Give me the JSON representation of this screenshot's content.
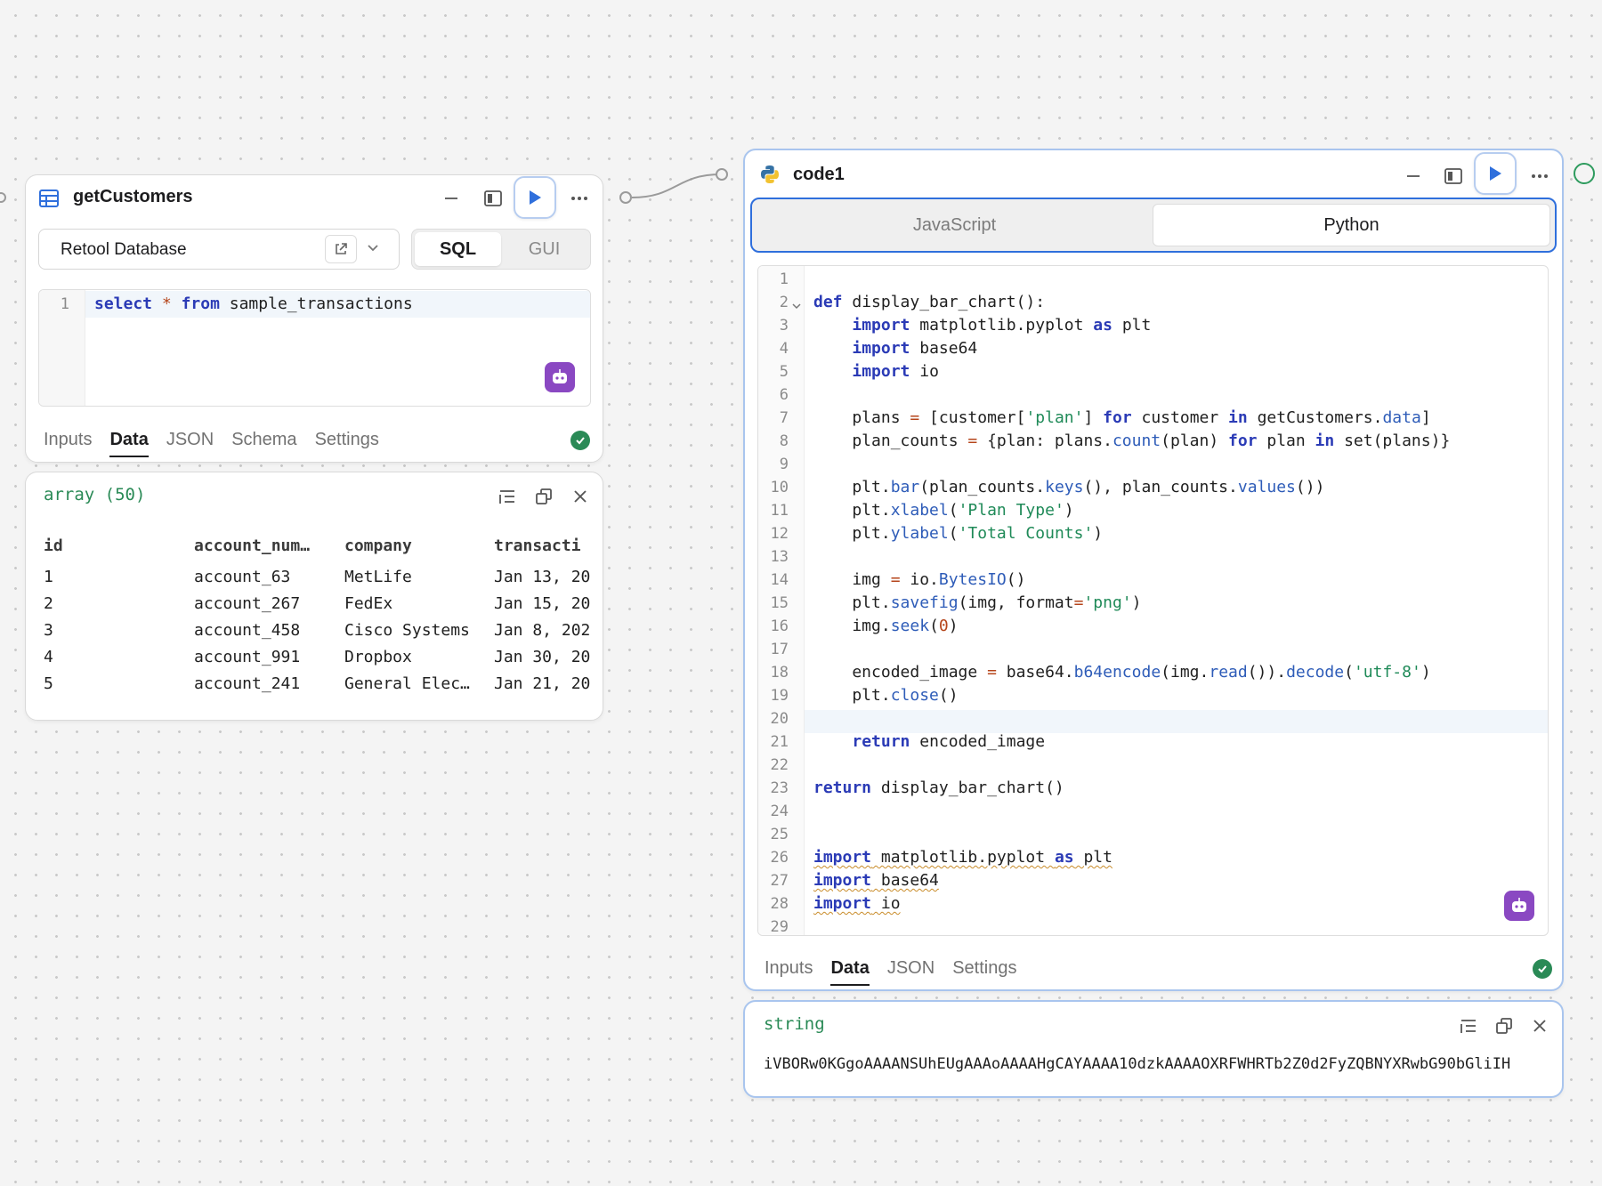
{
  "colors": {
    "accent": "#2f6fdc",
    "success": "#2a8a56",
    "ai": "#8a48c2",
    "keyword": "#2b3bb6",
    "string": "#1f8a58"
  },
  "query_block": {
    "title": "getCustomers",
    "icon": "table-icon",
    "resource": "Retool Database",
    "mode_options": [
      "SQL",
      "GUI"
    ],
    "selected_mode": "SQL",
    "code": {
      "line_number": "1",
      "text": "select * from sample_transactions"
    },
    "tabs": [
      "Inputs",
      "Data",
      "JSON",
      "Schema",
      "Settings"
    ],
    "active_tab": "Data"
  },
  "query_results": {
    "type_label": "array (50)",
    "columns": [
      "id",
      "account_num…",
      "company",
      "transacti"
    ],
    "rows": [
      [
        "1",
        "account_63",
        "MetLife",
        "Jan 13, 20"
      ],
      [
        "2",
        "account_267",
        "FedEx",
        "Jan 15, 20"
      ],
      [
        "3",
        "account_458",
        "Cisco Systems",
        "Jan 8, 202"
      ],
      [
        "4",
        "account_991",
        "Dropbox",
        "Jan 30, 20"
      ],
      [
        "5",
        "account_241",
        "General Elec…",
        "Jan 21, 20"
      ]
    ]
  },
  "code_block": {
    "title": "code1",
    "icon": "python-icon",
    "languages": [
      "JavaScript",
      "Python"
    ],
    "selected_language": "Python",
    "line_numbers": [
      "1",
      "2",
      "3",
      "4",
      "5",
      "6",
      "7",
      "8",
      "9",
      "10",
      "11",
      "12",
      "13",
      "14",
      "15",
      "16",
      "17",
      "18",
      "19",
      "20",
      "21",
      "22",
      "23",
      "24",
      "25",
      "26",
      "27",
      "28",
      "29"
    ],
    "code_lines": [
      "",
      "def display_bar_chart():",
      "    import matplotlib.pyplot as plt",
      "    import base64",
      "    import io",
      "",
      "    plans = [customer['plan'] for customer in getCustomers.data]",
      "    plan_counts = {plan: plans.count(plan) for plan in set(plans)}",
      "",
      "    plt.bar(plan_counts.keys(), plan_counts.values())",
      "    plt.xlabel('Plan Type')",
      "    plt.ylabel('Total Counts')",
      "",
      "    img = io.BytesIO()",
      "    plt.savefig(img, format='png')",
      "    img.seek(0)",
      "",
      "    encoded_image = base64.b64encode(img.read()).decode('utf-8')",
      "    plt.close()",
      "",
      "    return encoded_image",
      "",
      "return display_bar_chart()",
      "",
      "",
      "import matplotlib.pyplot as plt",
      "import base64",
      "import io",
      ""
    ],
    "highlighted_line": "20",
    "tabs": [
      "Inputs",
      "Data",
      "JSON",
      "Settings"
    ],
    "active_tab": "Data"
  },
  "code_results": {
    "type_label": "string",
    "value": "iVBORw0KGgoAAAANSUhEUgAAAoAAAAHgCAYAAAA10dzkAAAAOXRFWHRTb2Z0d2FyZQBNYXRwbG90bGliIH"
  }
}
